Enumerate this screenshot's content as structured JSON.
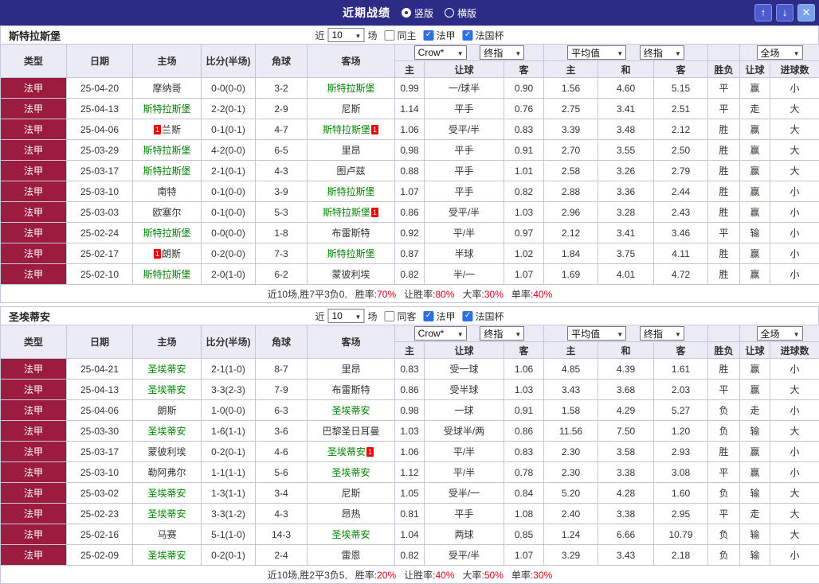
{
  "topbar": {
    "title": "近期战绩",
    "vertical_label": "竖版",
    "vertical_selected": true,
    "horizontal_label": "横版",
    "horizontal_selected": false,
    "up_glyph": "↑",
    "down_glyph": "↓",
    "close_glyph": "✕"
  },
  "colors": {
    "topbar_bg": "#2c2c87",
    "league_bg": "#9b1c3f",
    "head_bg": "#ebebf5",
    "grid": "#c5c5e0",
    "win": "#e60012",
    "draw": "#009933",
    "lose": "#0000e6",
    "score": "#ff5a00",
    "focus_team": "#008800"
  },
  "header": {
    "col_type": "类型",
    "col_date": "日期",
    "col_home": "主场",
    "col_score": "比分(半场)",
    "col_corner": "角球",
    "col_away": "客场",
    "bookmaker_select": "Crow*",
    "final_index_select": "终指",
    "average_select": "平均值",
    "scope_select": "全场",
    "sub_home": "主",
    "sub_handicap": "让球",
    "sub_away": "客",
    "sub_avg_home": "主",
    "sub_avg_draw": "和",
    "sub_avg_away": "客",
    "col_result": "胜负",
    "col_handicap_result": "让球",
    "col_goals": "进球数"
  },
  "tables": [
    {
      "team": "斯特拉斯堡",
      "filter": {
        "near": "近",
        "count": "10",
        "games": "场",
        "same_label": "同主",
        "same_checked": false,
        "league_label": "法甲",
        "league_checked": true,
        "cup_label": "法国杯",
        "cup_checked": true
      },
      "rows": [
        {
          "league": "法甲",
          "date": "25-04-20",
          "home": "摩纳哥",
          "home_focus": false,
          "home_card": "",
          "score": "0-0(0-0)",
          "corner": "3-2",
          "away": "斯特拉斯堡",
          "away_focus": true,
          "away_card": "",
          "odds": [
            "0.99",
            "一/球半",
            "0.90"
          ],
          "avg": [
            "1.56",
            "4.60",
            "5.15"
          ],
          "result": "平",
          "handicap_result": "赢",
          "goals": "小"
        },
        {
          "league": "法甲",
          "date": "25-04-13",
          "home": "斯特拉斯堡",
          "home_focus": true,
          "home_card": "",
          "score": "2-2(0-1)",
          "corner": "2-9",
          "away": "尼斯",
          "away_focus": false,
          "away_card": "",
          "odds": [
            "1.14",
            "平手",
            "0.76"
          ],
          "avg": [
            "2.75",
            "3.41",
            "2.51"
          ],
          "result": "平",
          "handicap_result": "走",
          "goals": "大"
        },
        {
          "league": "法甲",
          "date": "25-04-06",
          "home": "兰斯",
          "home_focus": false,
          "home_card": "1",
          "score": "0-1(0-1)",
          "corner": "4-7",
          "away": "斯特拉斯堡",
          "away_focus": true,
          "away_card": "1",
          "odds": [
            "1.06",
            "受平/半",
            "0.83"
          ],
          "avg": [
            "3.39",
            "3.48",
            "2.12"
          ],
          "result": "胜",
          "handicap_result": "赢",
          "goals": "大"
        },
        {
          "league": "法甲",
          "date": "25-03-29",
          "home": "斯特拉斯堡",
          "home_focus": true,
          "home_card": "",
          "score": "4-2(0-0)",
          "corner": "6-5",
          "away": "里昂",
          "away_focus": false,
          "away_card": "",
          "odds": [
            "0.98",
            "平手",
            "0.91"
          ],
          "avg": [
            "2.70",
            "3.55",
            "2.50"
          ],
          "result": "胜",
          "handicap_result": "赢",
          "goals": "大"
        },
        {
          "league": "法甲",
          "date": "25-03-17",
          "home": "斯特拉斯堡",
          "home_focus": true,
          "home_card": "",
          "score": "2-1(0-1)",
          "corner": "4-3",
          "away": "图卢兹",
          "away_focus": false,
          "away_card": "",
          "odds": [
            "0.88",
            "平手",
            "1.01"
          ],
          "avg": [
            "2.58",
            "3.26",
            "2.79"
          ],
          "result": "胜",
          "handicap_result": "赢",
          "goals": "大"
        },
        {
          "league": "法甲",
          "date": "25-03-10",
          "home": "南特",
          "home_focus": false,
          "home_card": "",
          "score": "0-1(0-0)",
          "corner": "3-9",
          "away": "斯特拉斯堡",
          "away_focus": true,
          "away_card": "",
          "odds": [
            "1.07",
            "平手",
            "0.82"
          ],
          "avg": [
            "2.88",
            "3.36",
            "2.44"
          ],
          "result": "胜",
          "handicap_result": "赢",
          "goals": "小"
        },
        {
          "league": "法甲",
          "date": "25-03-03",
          "home": "欧塞尔",
          "home_focus": false,
          "home_card": "",
          "score": "0-1(0-0)",
          "corner": "5-3",
          "away": "斯特拉斯堡",
          "away_focus": true,
          "away_card": "1",
          "odds": [
            "0.86",
            "受平/半",
            "1.03"
          ],
          "avg": [
            "2.96",
            "3.28",
            "2.43"
          ],
          "result": "胜",
          "handicap_result": "赢",
          "goals": "小"
        },
        {
          "league": "法甲",
          "date": "25-02-24",
          "home": "斯特拉斯堡",
          "home_focus": true,
          "home_card": "",
          "score": "0-0(0-0)",
          "corner": "1-8",
          "away": "布雷斯特",
          "away_focus": false,
          "away_card": "",
          "odds": [
            "0.92",
            "平/半",
            "0.97"
          ],
          "avg": [
            "2.12",
            "3.41",
            "3.46"
          ],
          "result": "平",
          "handicap_result": "输",
          "goals": "小"
        },
        {
          "league": "法甲",
          "date": "25-02-17",
          "home": "朗斯",
          "home_focus": false,
          "home_card": "1",
          "score": "0-2(0-0)",
          "corner": "7-3",
          "away": "斯特拉斯堡",
          "away_focus": true,
          "away_card": "",
          "odds": [
            "0.87",
            "半球",
            "1.02"
          ],
          "avg": [
            "1.84",
            "3.75",
            "4.11"
          ],
          "result": "胜",
          "handicap_result": "赢",
          "goals": "小"
        },
        {
          "league": "法甲",
          "date": "25-02-10",
          "home": "斯特拉斯堡",
          "home_focus": true,
          "home_card": "",
          "score": "2-0(1-0)",
          "corner": "6-2",
          "away": "蒙彼利埃",
          "away_focus": false,
          "away_card": "",
          "odds": [
            "0.82",
            "半/一",
            "1.07"
          ],
          "avg": [
            "1.69",
            "4.01",
            "4.72"
          ],
          "result": "胜",
          "handicap_result": "赢",
          "goals": "小"
        }
      ],
      "summary": {
        "prefix": "近10场,胜7平3负0,",
        "stats": [
          {
            "label": "胜率:",
            "value": "70%"
          },
          {
            "label": "让胜率:",
            "value": "80%"
          },
          {
            "label": "大率:",
            "value": "30%"
          },
          {
            "label": "单率:",
            "value": "40%"
          }
        ]
      }
    },
    {
      "team": "圣埃蒂安",
      "filter": {
        "near": "近",
        "count": "10",
        "games": "场",
        "same_label": "同客",
        "same_checked": false,
        "league_label": "法甲",
        "league_checked": true,
        "cup_label": "法国杯",
        "cup_checked": true
      },
      "rows": [
        {
          "league": "法甲",
          "date": "25-04-21",
          "home": "圣埃蒂安",
          "home_focus": true,
          "home_card": "",
          "score": "2-1(1-0)",
          "corner": "8-7",
          "away": "里昂",
          "away_focus": false,
          "away_card": "",
          "odds": [
            "0.83",
            "受一球",
            "1.06"
          ],
          "avg": [
            "4.85",
            "4.39",
            "1.61"
          ],
          "result": "胜",
          "handicap_result": "赢",
          "goals": "小"
        },
        {
          "league": "法甲",
          "date": "25-04-13",
          "home": "圣埃蒂安",
          "home_focus": true,
          "home_card": "",
          "score": "3-3(2-3)",
          "corner": "7-9",
          "away": "布雷斯特",
          "away_focus": false,
          "away_card": "",
          "odds": [
            "0.86",
            "受半球",
            "1.03"
          ],
          "avg": [
            "3.43",
            "3.68",
            "2.03"
          ],
          "result": "平",
          "handicap_result": "赢",
          "goals": "大"
        },
        {
          "league": "法甲",
          "date": "25-04-06",
          "home": "朗斯",
          "home_focus": false,
          "home_card": "",
          "score": "1-0(0-0)",
          "corner": "6-3",
          "away": "圣埃蒂安",
          "away_focus": true,
          "away_card": "",
          "odds": [
            "0.98",
            "一球",
            "0.91"
          ],
          "avg": [
            "1.58",
            "4.29",
            "5.27"
          ],
          "result": "负",
          "handicap_result": "走",
          "goals": "小"
        },
        {
          "league": "法甲",
          "date": "25-03-30",
          "home": "圣埃蒂安",
          "home_focus": true,
          "home_card": "",
          "score": "1-6(1-1)",
          "corner": "3-6",
          "away": "巴黎圣日耳曼",
          "away_focus": false,
          "away_card": "",
          "odds": [
            "1.03",
            "受球半/两",
            "0.86"
          ],
          "avg": [
            "11.56",
            "7.50",
            "1.20"
          ],
          "result": "负",
          "handicap_result": "输",
          "goals": "大"
        },
        {
          "league": "法甲",
          "date": "25-03-17",
          "home": "蒙彼利埃",
          "home_focus": false,
          "home_card": "",
          "score": "0-2(0-1)",
          "corner": "4-6",
          "away": "圣埃蒂安",
          "away_focus": true,
          "away_card": "1",
          "odds": [
            "1.06",
            "平/半",
            "0.83"
          ],
          "avg": [
            "2.30",
            "3.58",
            "2.93"
          ],
          "result": "胜",
          "handicap_result": "赢",
          "goals": "小"
        },
        {
          "league": "法甲",
          "date": "25-03-10",
          "home": "勒阿弗尔",
          "home_focus": false,
          "home_card": "",
          "score": "1-1(1-1)",
          "corner": "5-6",
          "away": "圣埃蒂安",
          "away_focus": true,
          "away_card": "",
          "odds": [
            "1.12",
            "平/半",
            "0.78"
          ],
          "avg": [
            "2.30",
            "3.38",
            "3.08"
          ],
          "result": "平",
          "handicap_result": "赢",
          "goals": "小"
        },
        {
          "league": "法甲",
          "date": "25-03-02",
          "home": "圣埃蒂安",
          "home_focus": true,
          "home_card": "",
          "score": "1-3(1-1)",
          "corner": "3-4",
          "away": "尼斯",
          "away_focus": false,
          "away_card": "",
          "odds": [
            "1.05",
            "受半/一",
            "0.84"
          ],
          "avg": [
            "5.20",
            "4.28",
            "1.60"
          ],
          "result": "负",
          "handicap_result": "输",
          "goals": "大"
        },
        {
          "league": "法甲",
          "date": "25-02-23",
          "home": "圣埃蒂安",
          "home_focus": true,
          "home_card": "",
          "score": "3-3(1-2)",
          "corner": "4-3",
          "away": "昂热",
          "away_focus": false,
          "away_card": "",
          "odds": [
            "0.81",
            "平手",
            "1.08"
          ],
          "avg": [
            "2.40",
            "3.38",
            "2.95"
          ],
          "result": "平",
          "handicap_result": "走",
          "goals": "大"
        },
        {
          "league": "法甲",
          "date": "25-02-16",
          "home": "马赛",
          "home_focus": false,
          "home_card": "",
          "score": "5-1(1-0)",
          "corner": "14-3",
          "away": "圣埃蒂安",
          "away_focus": true,
          "away_card": "",
          "odds": [
            "1.04",
            "两球",
            "0.85"
          ],
          "avg": [
            "1.24",
            "6.66",
            "10.79"
          ],
          "result": "负",
          "handicap_result": "输",
          "goals": "大"
        },
        {
          "league": "法甲",
          "date": "25-02-09",
          "home": "圣埃蒂安",
          "home_focus": true,
          "home_card": "",
          "score": "0-2(0-1)",
          "corner": "2-4",
          "away": "雷恩",
          "away_focus": false,
          "away_card": "",
          "odds": [
            "0.82",
            "受平/半",
            "1.07"
          ],
          "avg": [
            "3.29",
            "3.43",
            "2.18"
          ],
          "result": "负",
          "handicap_result": "输",
          "goals": "小"
        }
      ],
      "summary": {
        "prefix": "近10场,胜2平3负5,",
        "stats": [
          {
            "label": "胜率:",
            "value": "20%"
          },
          {
            "label": "让胜率:",
            "value": "40%"
          },
          {
            "label": "大率:",
            "value": "50%"
          },
          {
            "label": "单率:",
            "value": "30%"
          }
        ]
      }
    }
  ]
}
